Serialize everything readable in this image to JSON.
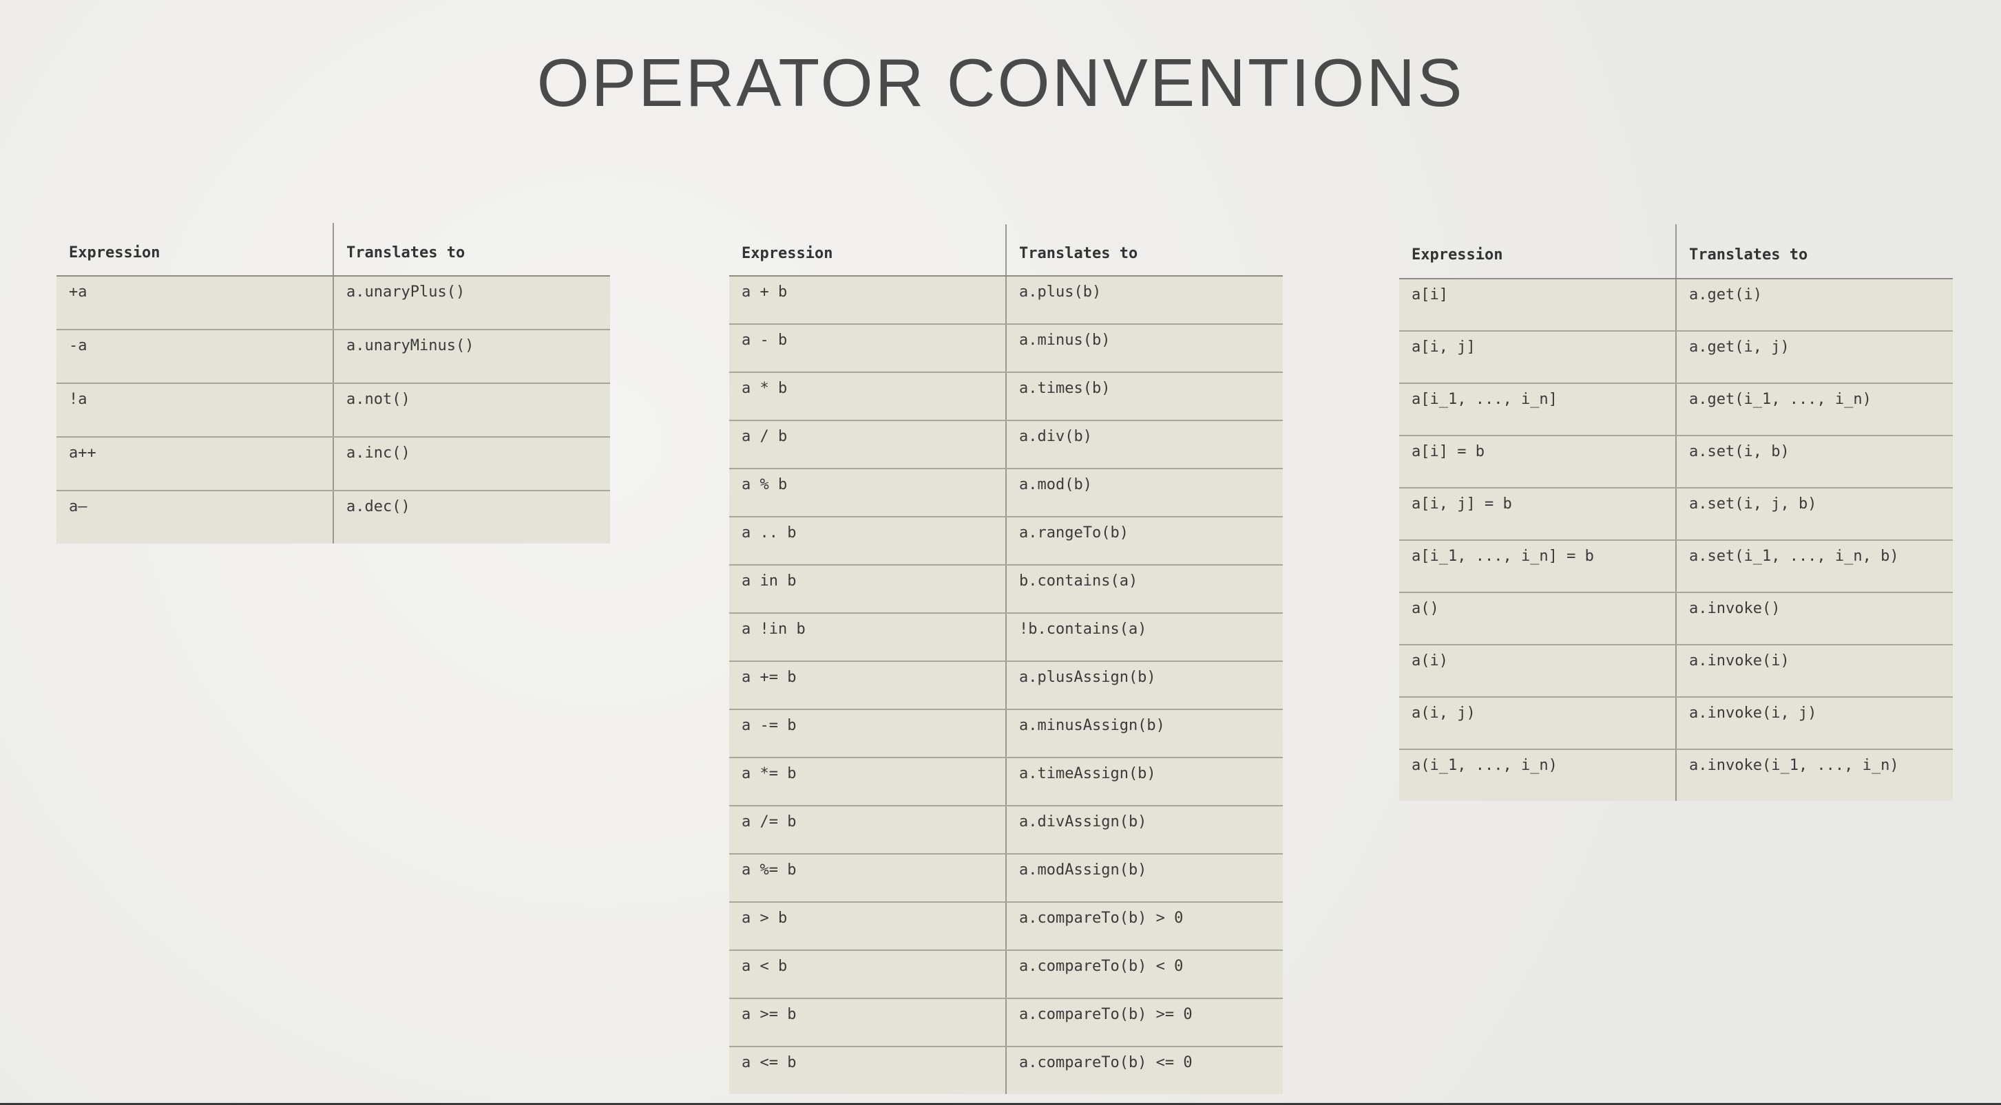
{
  "title": "OPERATOR CONVENTIONS",
  "tables": [
    {
      "headers": [
        "Expression",
        "Translates to"
      ],
      "rows": [
        [
          "+a",
          "a.unaryPlus()"
        ],
        [
          "-a",
          "a.unaryMinus()"
        ],
        [
          "!a",
          "a.not()"
        ],
        [
          "a++",
          "a.inc()"
        ],
        [
          "a—",
          "a.dec()"
        ]
      ]
    },
    {
      "headers": [
        "Expression",
        "Translates to"
      ],
      "rows": [
        [
          "a + b",
          "a.plus(b)"
        ],
        [
          "a - b",
          "a.minus(b)"
        ],
        [
          "a * b",
          "a.times(b)"
        ],
        [
          "a / b",
          "a.div(b)"
        ],
        [
          "a % b",
          "a.mod(b)"
        ],
        [
          "a .. b",
          "a.rangeTo(b)"
        ],
        [
          "a in b",
          "b.contains(a)"
        ],
        [
          "a !in b",
          "!b.contains(a)"
        ],
        [
          "a += b",
          "a.plusAssign(b)"
        ],
        [
          "a -= b",
          "a.minusAssign(b)"
        ],
        [
          "a *= b",
          "a.timeAssign(b)"
        ],
        [
          "a /= b",
          "a.divAssign(b)"
        ],
        [
          "a %= b",
          "a.modAssign(b)"
        ],
        [
          "a > b",
          "a.compareTo(b) > 0"
        ],
        [
          "a < b",
          "a.compareTo(b) < 0"
        ],
        [
          "a >= b",
          "a.compareTo(b) >= 0"
        ],
        [
          "a <= b",
          "a.compareTo(b) <= 0"
        ]
      ]
    },
    {
      "headers": [
        "Expression",
        "Translates to"
      ],
      "rows": [
        [
          "a[i]",
          "a.get(i)"
        ],
        [
          "a[i, j]",
          "a.get(i, j)"
        ],
        [
          "a[i_1, ..., i_n]",
          "a.get(i_1, ..., i_n)"
        ],
        [
          "a[i] = b",
          "a.set(i, b)"
        ],
        [
          "a[i, j] = b",
          "a.set(i, j, b)"
        ],
        [
          "a[i_1, ..., i_n] = b",
          "a.set(i_1, ..., i_n, b)"
        ],
        [
          "a()",
          "a.invoke()"
        ],
        [
          "a(i)",
          "a.invoke(i)"
        ],
        [
          "a(i, j)",
          "a.invoke(i, j)"
        ],
        [
          "a(i_1, ..., i_n)",
          "a.invoke(i_1, ..., i_n)"
        ]
      ]
    }
  ]
}
